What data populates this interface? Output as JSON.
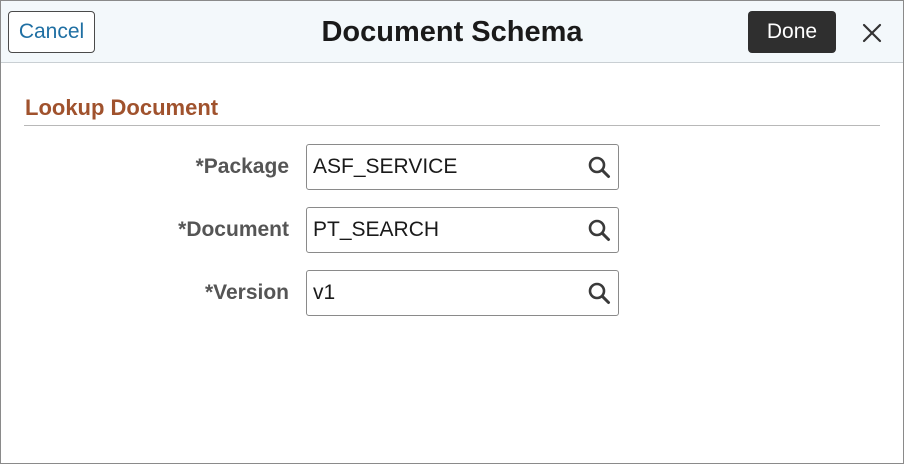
{
  "header": {
    "cancel_label": "Cancel",
    "title": "Document Schema",
    "done_label": "Done",
    "close_icon": "close-icon"
  },
  "section": {
    "title": "Lookup Document"
  },
  "fields": [
    {
      "label": "*Package",
      "value": "ASF_SERVICE",
      "icon": "search-icon"
    },
    {
      "label": "*Document",
      "value": "PT_SEARCH",
      "icon": "search-icon"
    },
    {
      "label": "*Version",
      "value": "v1",
      "icon": "search-icon"
    }
  ],
  "colors": {
    "header_bg": "#f3f8fb",
    "cancel_text": "#1f6fa3",
    "done_bg": "#2f2f2f",
    "section_title": "#a0522d",
    "label_text": "#555555"
  }
}
